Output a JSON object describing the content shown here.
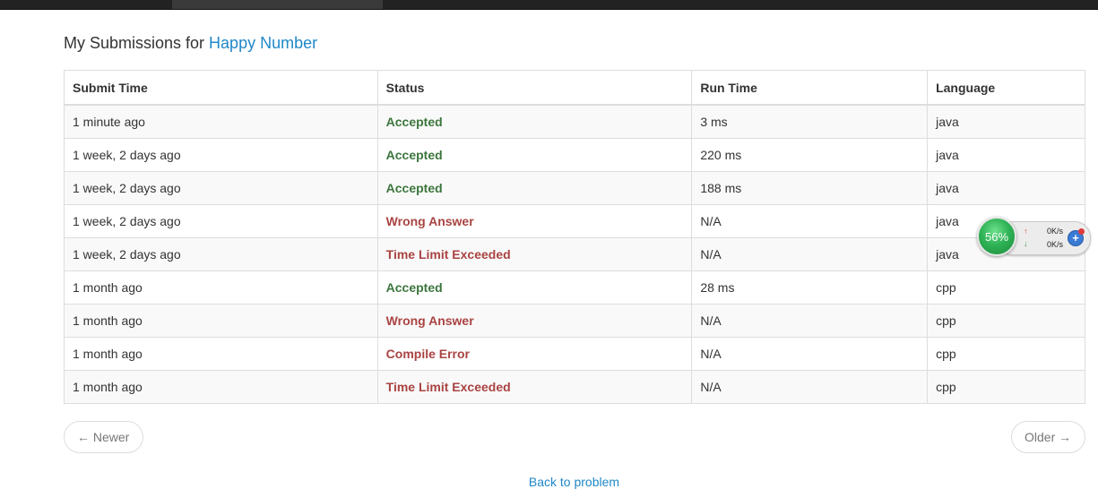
{
  "heading": {
    "prefix": "My Submissions for ",
    "problem": "Happy Number"
  },
  "table": {
    "columns": [
      "Submit Time",
      "Status",
      "Run Time",
      "Language"
    ],
    "rows": [
      {
        "time": "1 minute ago",
        "status": "Accepted",
        "runtime": "3 ms",
        "lang": "java"
      },
      {
        "time": "1 week, 2 days ago",
        "status": "Accepted",
        "runtime": "220 ms",
        "lang": "java"
      },
      {
        "time": "1 week, 2 days ago",
        "status": "Accepted",
        "runtime": "188 ms",
        "lang": "java"
      },
      {
        "time": "1 week, 2 days ago",
        "status": "Wrong Answer",
        "runtime": "N/A",
        "lang": "java"
      },
      {
        "time": "1 week, 2 days ago",
        "status": "Time Limit Exceeded",
        "runtime": "N/A",
        "lang": "java"
      },
      {
        "time": "1 month ago",
        "status": "Accepted",
        "runtime": "28 ms",
        "lang": "cpp"
      },
      {
        "time": "1 month ago",
        "status": "Wrong Answer",
        "runtime": "N/A",
        "lang": "cpp"
      },
      {
        "time": "1 month ago",
        "status": "Compile Error",
        "runtime": "N/A",
        "lang": "cpp"
      },
      {
        "time": "1 month ago",
        "status": "Time Limit Exceeded",
        "runtime": "N/A",
        "lang": "cpp"
      }
    ]
  },
  "pager": {
    "newer": "← Newer",
    "older": "Older →"
  },
  "back_link": "Back to problem",
  "net_widget": {
    "percent": "56%",
    "up_speed": "0K/s",
    "down_speed": "0K/s",
    "up_arrow": "↑",
    "down_arrow": "↓",
    "plus": "+"
  },
  "colors": {
    "accepted": "#3c763d",
    "error": "#a94442",
    "link": "#1f88c9"
  }
}
